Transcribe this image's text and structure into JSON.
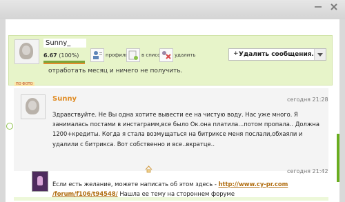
{
  "header": {
    "username": "Sunny_",
    "rating": "6.67",
    "percent": "(100%)",
    "actions": [
      {
        "label": "профиль"
      },
      {
        "label": "в список"
      },
      {
        "label": "удалить"
      }
    ],
    "menu_label": "Удалить сообщения...",
    "tag": "ПО ФОТО"
  },
  "messages": {
    "previous_line": "отработать месяц и ничего не получить.",
    "first": {
      "sender": "Sunny",
      "time": "сегодня 21:28",
      "text": "Здравствуйте. Не Вы одна хотите вывести ее на чистую воду. Нас уже много. Я занималась постами в инстаграмм,все было Ок.она платила...потом пропала.. Должна 1200+кредиты. Когда я стала возмущаться на битриксе меня послали,обхаяли и удалили с битрикса. Вот собственно и все..вкратце.."
    },
    "second": {
      "time": "сегодня 21:42",
      "text_prefix": "Если есть желание, можете написать об этом здесь - ",
      "link_part1": "http://www.cy-pr.com",
      "link_part2": "/forum/f106/t94548/",
      "text_suffix": " Нашла ее тему на стороннем форуме"
    }
  },
  "colors": {
    "accent": "#e08c24",
    "header_bg": "#e7f4c9",
    "link": "#b06d10",
    "green": "#69ad1f"
  },
  "icons": [
    "minimize-icon",
    "close-icon",
    "profile-icon",
    "list-icon",
    "delete-icon",
    "plus-icon",
    "dropdown-arrow-icon",
    "home-icon"
  ]
}
